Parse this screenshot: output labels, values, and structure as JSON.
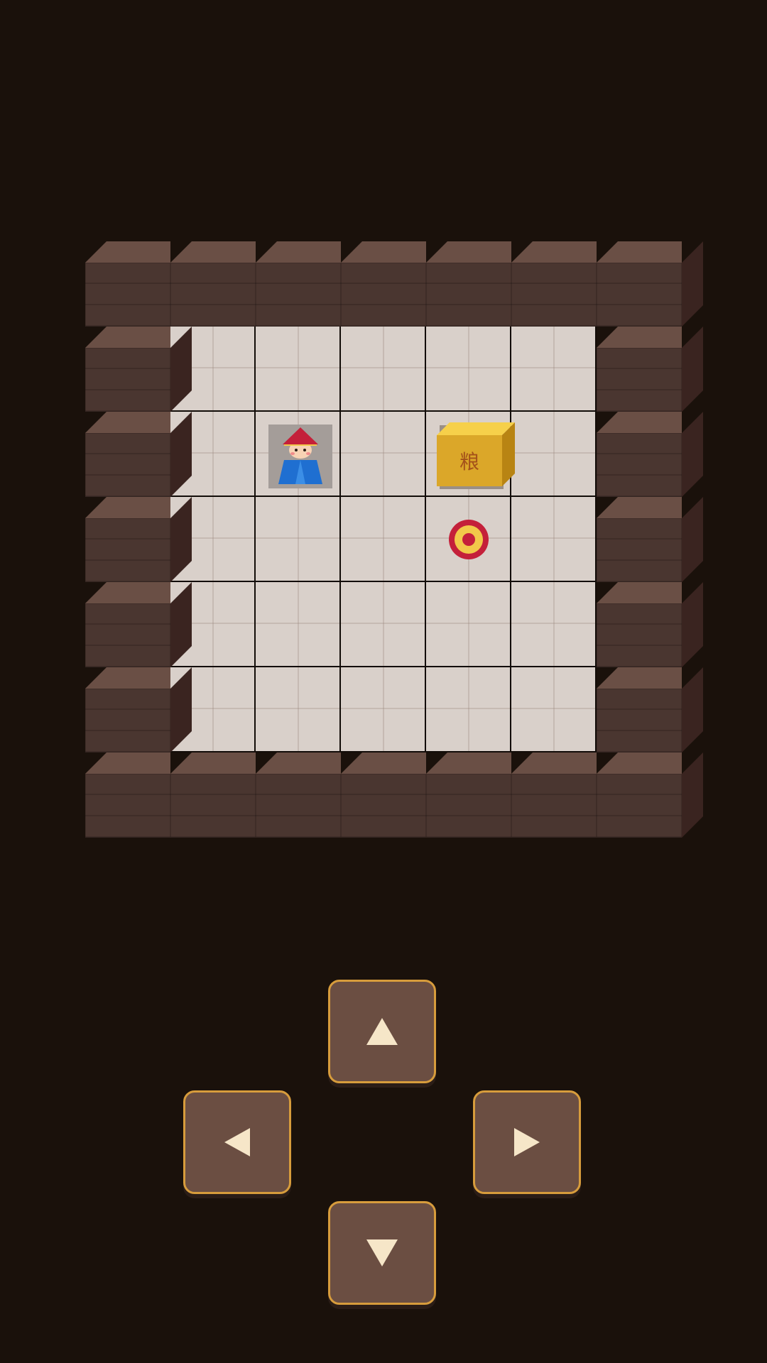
{
  "game": {
    "type": "sokoban",
    "board": {
      "cols": 7,
      "rows": 7,
      "layout": [
        "#######",
        "#.....#",
        "#.P.B.#",
        "#...T.#",
        "#.....#",
        "#.....#",
        "#######"
      ]
    },
    "box": {
      "label": "粮",
      "color": "#dba729",
      "text_color": "#a4521a"
    },
    "player": {
      "hat_color": "#c4203a",
      "robe_color": "#1f6fd1"
    },
    "target": {
      "outer_color": "#c4203a",
      "inner_color": "#f2c84a"
    }
  },
  "controls": {
    "up": {
      "icon": "arrow-up-icon"
    },
    "down": {
      "icon": "arrow-down-icon"
    },
    "left": {
      "icon": "arrow-left-icon"
    },
    "right": {
      "icon": "arrow-right-icon"
    }
  },
  "colors": {
    "background": "#1a110b",
    "wall_front": "#4a3630",
    "wall_top": "#6a4f45",
    "floor": "#d9d0ca",
    "button_fill": "#6b4e42",
    "button_border": "#d79c3c",
    "arrow": "#f6e6c8"
  }
}
